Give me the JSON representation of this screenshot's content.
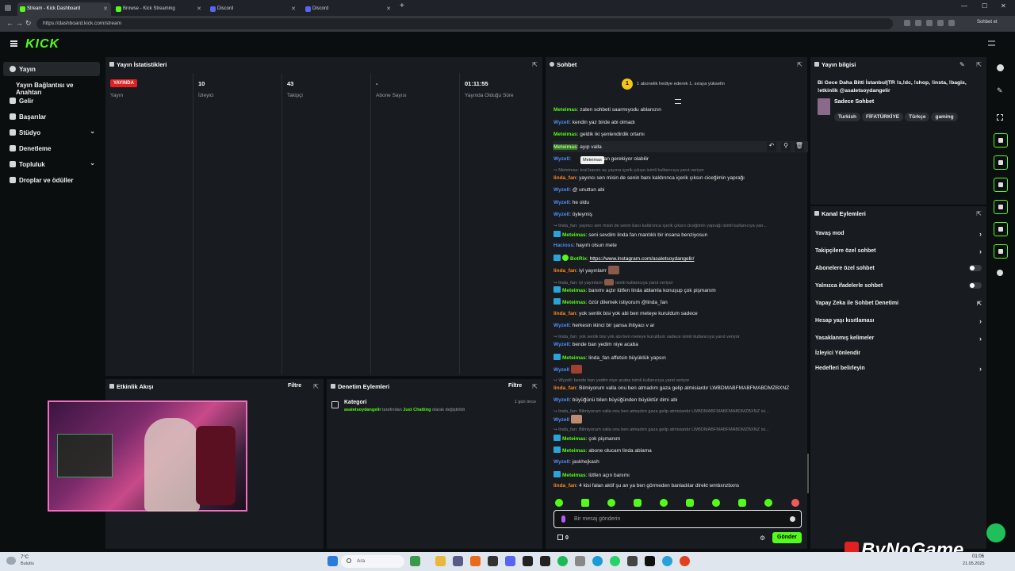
{
  "browser": {
    "tabs": [
      {
        "label": "Stream - Kick Dashboard"
      },
      {
        "label": "Browse - Kick Streaming"
      },
      {
        "label": "Discord"
      },
      {
        "label": "Discord"
      }
    ],
    "url": "https://dashboard.kick.com/stream",
    "profile_label": "Sohbet et"
  },
  "kick": {
    "logo": "KICK"
  },
  "leftnav": {
    "items": [
      {
        "label": "Yayın"
      },
      {
        "label": "Yayın Bağlantısı ve Anahtarı"
      },
      {
        "label": "Gelir"
      },
      {
        "label": "Başarılar"
      },
      {
        "label": "Stüdyo"
      },
      {
        "label": "Denetleme"
      },
      {
        "label": "Topluluk"
      },
      {
        "label": "Droplar ve ödüller"
      }
    ]
  },
  "stats": {
    "title": "Yayın İstatistikleri",
    "live_badge": "YAYINDA",
    "status_label": "Yayın",
    "cols": [
      {
        "value": "10",
        "label": "İzleyici"
      },
      {
        "value": "43",
        "label": "Takipçi"
      },
      {
        "value": "-",
        "label": "Abone Sayısı"
      },
      {
        "value": "01:11:55",
        "label": "Yayında Olduğu Süre"
      }
    ]
  },
  "activity": {
    "title": "Etkinlik Akışı",
    "filter": "Filtre"
  },
  "moderation": {
    "title": "Denetim Eylemleri",
    "filter": "Filtre",
    "entry_title": "Kategori",
    "entry_user": "asaletsoydangelir",
    "entry_text": " tarafından ",
    "entry_cat": "Just Chatting",
    "entry_tail": " olarak değiştirildi",
    "entry_time": "1 gün önce"
  },
  "chat": {
    "title": "Sohbet",
    "pinned": "1 abonelik hediye ederek 1. sıraya yükselin",
    "pinned_rank": "1",
    "tooltip": "Meteimas",
    "placeholder": "Bir mesaj gönderin",
    "points": "0",
    "send": "Gönder",
    "messages": [
      {
        "user": "Meteimas",
        "text": ": zaten sohbeti saarmıyodu ablanızın"
      },
      {
        "user": "Wyzell",
        "text": ": kendin yaz birde abi olmadı"
      },
      {
        "user": "Meteimas",
        "text": ": geldik iki şenlendirdik ortamı"
      },
      {
        "user": "Meteimas",
        "text": ": ayıp valla"
      },
      {
        "user": "Wyzell",
        "text": ": ",
        "text2": "an gerekiyor olabilir"
      },
      {
        "reply": "Meteimas: kral banını aç yayına içerik çıkıyo isimli kullanıcıya yanıt veriyor"
      },
      {
        "user": "linda_fan",
        "text": ": yayıncı sen misin de senin banı kaldırınca içerik çıksın ciceğimin yaprağı"
      },
      {
        "user": "Wyzell",
        "text": ": @ unuttun abi"
      },
      {
        "user": "Wyzell",
        "text": ": he oldu"
      },
      {
        "user": "Wyzell",
        "text": ": öyleymiş"
      },
      {
        "reply": "linda_fan: yayıncı sen misin de senin banı kaldırınca içerik çıksın ciceğimin yaprağı isimli kullanıcıya yan..."
      },
      {
        "user": "Meteimas",
        "text": ": seni sevdim linda fan mantıklı bir insana benziyosun"
      },
      {
        "user": "Hacioss",
        "text": ": hayırlı olsun mete"
      },
      {
        "user": "BotRix",
        "text": ": ",
        "link": "https://www.instagram.com/asaletsoydangelir/"
      },
      {
        "user": "linda_fan",
        "text": ": iyi yayınlarrr"
      },
      {
        "reply": "linda_fan: iyi yayınlarrr",
        "reply2": "isimli kullanıcıya yanıt veriyor"
      },
      {
        "user": "Meteimas",
        "text": ": banımı açtır lütfen linda ablamla konuşup çok pişmanım"
      },
      {
        "user": "Meteimas",
        "text": ": özür dilemek istiyorum @linda_fan"
      },
      {
        "user": "linda_fan",
        "text": ": yok senlik bisi yok abi ben meteye kuruldum sadece"
      },
      {
        "user": "Wyzell",
        "text": ": herkesin ikinci bir şansa ihtiyacı v ar"
      },
      {
        "reply": "linda_fan: yok senlik bisi yok abi ben meteye kuruldum sadece isimli kullanıcıya yanıt veriyor"
      },
      {
        "user": "Wyzell",
        "text": ": bende ban yedim niye acaba"
      },
      {
        "user": "Meteimas",
        "text": ": linda_fan affetsin büyüklük yapsın"
      },
      {
        "user": "Wyzell",
        "text": ":"
      },
      {
        "reply": "Wyzell: bende ban yedim niye acaba isimli kullanıcıya yanıt veriyor"
      },
      {
        "user": "linda_fan",
        "text": ": Bilmiyorum valla onu ben atmadım gaza gelip atmisiardır LWBDMABFMABFMABDMZBXNZ"
      },
      {
        "user": "Wyzell",
        "text": ": büyüğünü bilen büyüğünden büyüktür dimi abi"
      },
      {
        "reply": "linda_fan: Bilmiyorum valla onu ben atmadım gaza gelip atmisiardır LWBDMABFMABFMABDMZBXNZ isi..."
      },
      {
        "user": "Wyzell",
        "text": ":"
      },
      {
        "reply": "linda_fan: Bilmiyorum valla onu ben atmadım gaza gelip atmisiardır LWBDMABFMABFMABDMZBXNZ isi..."
      },
      {
        "user": "Meteimas",
        "text": ": çok pişmanım"
      },
      {
        "user": "Meteimas",
        "text": ": abone olucam linda ablama"
      },
      {
        "user": "Wyzell",
        "text": ": jaskhejkash"
      },
      {
        "user": "Meteimas",
        "text": ": lütfen açın banımı"
      },
      {
        "user": "linda_fan",
        "text": ": 4 kisi falan aktif şu an ya ben görmeden banladılar direkt wmbxnzbxns"
      }
    ]
  },
  "streaminfo": {
    "title": "Yayın bilgisi",
    "stream_title": "Bi Gece Daha Bitti İstanbul|TR !s,!dc, !shop, !insta, !bagis, !etkinlik @asaletsoydangelir",
    "category": "Sadece Sohbet",
    "tags": [
      "Turkish",
      "FİFATÜRKİYE",
      "Türkçe",
      "gaming"
    ]
  },
  "channel_actions": {
    "title": "Kanal Eylemleri",
    "items": [
      {
        "label": "Yavaş mod"
      },
      {
        "label": "Takipçilere özel sohbet"
      },
      {
        "label": "Abonelere özel sohbet"
      },
      {
        "label": "Yalnızca ifadelerle sohbet"
      },
      {
        "label": "Yapay Zeka ile Sohbet Denetimi"
      },
      {
        "label": "Hesap yaşı kısıtlaması"
      },
      {
        "label": "Yasaklanmış kelimeler"
      },
      {
        "label": "İzleyici Yönlendir"
      },
      {
        "label": "Hedefleri belirleyin"
      }
    ]
  },
  "taskbar": {
    "weather_temp": "7°C",
    "weather_text": "Bulutlu",
    "search": "Ara",
    "time": "01:06",
    "date": "21.05.2025"
  },
  "watermark": "ByNoGame",
  "colors": {
    "accent": "#53fc18",
    "live": "#e0211f",
    "panel": "#181b1f",
    "bg": "#0b0e0f"
  }
}
